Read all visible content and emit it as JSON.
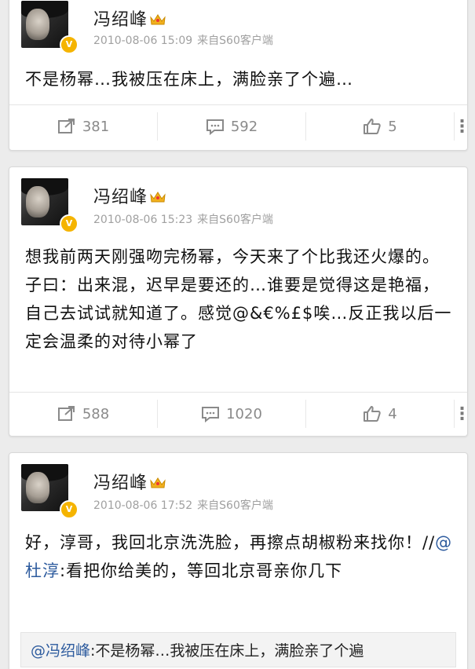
{
  "posts": [
    {
      "username": "冯绍峰",
      "timestamp": "2010-08-06 15:09",
      "source": "来自S60客户端",
      "text": "不是杨幂…我被压在床上，满脸亲了个遍…",
      "reposts": "381",
      "comments": "592",
      "likes": "5"
    },
    {
      "username": "冯绍峰",
      "timestamp": "2010-08-06 15:23",
      "source": "来自S60客户端",
      "text": "想我前两天刚强吻完杨幂，今天来了个比我还火爆的。子曰：出来混，迟早是要还的…谁要是觉得这是艳福，自己去试试就知道了。感觉@&€%£$唉…反正我以后一定会温柔的对待小幂了",
      "reposts": "588",
      "comments": "1020",
      "likes": "4"
    },
    {
      "username": "冯绍峰",
      "timestamp": "2010-08-06 17:52",
      "source": "来自S60客户端",
      "text_before": "好，淳哥，我回北京洗洗脸，再擦点胡椒粉来找你！//",
      "text_mention": "@杜淳",
      "text_after": ":看把你给美的，等回北京哥亲你几下",
      "quote_mention": "@冯绍峰",
      "quote_text": ":不是杨幂…我被压在床上，满脸亲了个遍"
    }
  ],
  "icons": {
    "repost": "repost-icon",
    "comment": "comment-icon",
    "like": "thumbs-up-icon",
    "more": "more-vertical-icon",
    "crown": "crown-icon",
    "verified": "verified-badge-icon"
  },
  "colors": {
    "background": "#ececec",
    "mention": "#2d5b9e",
    "meta": "#a0a0a0",
    "badge": "#f5b400"
  }
}
